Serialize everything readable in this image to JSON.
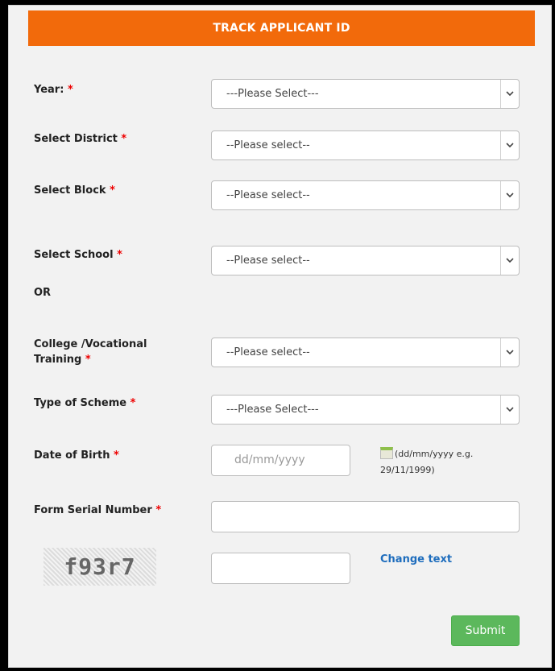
{
  "header": {
    "title": "TRACK APPLICANT ID"
  },
  "required_mark": "*",
  "fields": {
    "year": {
      "label": "Year:",
      "value": "---Please Select---"
    },
    "district": {
      "label": "Select District",
      "value": "--Please select--"
    },
    "block": {
      "label": "Select Block",
      "value": "--Please select--"
    },
    "school": {
      "label": "Select School",
      "value": "--Please select--"
    },
    "or_text": "OR",
    "college": {
      "label_line1": "College /Vocational",
      "label_line2": "Training",
      "value": "--Please select--"
    },
    "scheme": {
      "label": "Type of Scheme",
      "value": "---Please Select---"
    },
    "dob": {
      "label": "Date of Birth",
      "placeholder": "dd/mm/yyyy",
      "hint_line1": "(dd/mm/yyyy e.g.",
      "hint_line2": "29/11/1999)"
    },
    "serial": {
      "label": "Form Serial Number",
      "value": ""
    },
    "captcha": {
      "text": "f93r7",
      "value": "",
      "change_label": "Change text"
    }
  },
  "submit_label": "Submit",
  "colors": {
    "header": "#f26a0b",
    "submit": "#5cb85c",
    "link": "#1e6dbd",
    "required": "#e00000"
  }
}
